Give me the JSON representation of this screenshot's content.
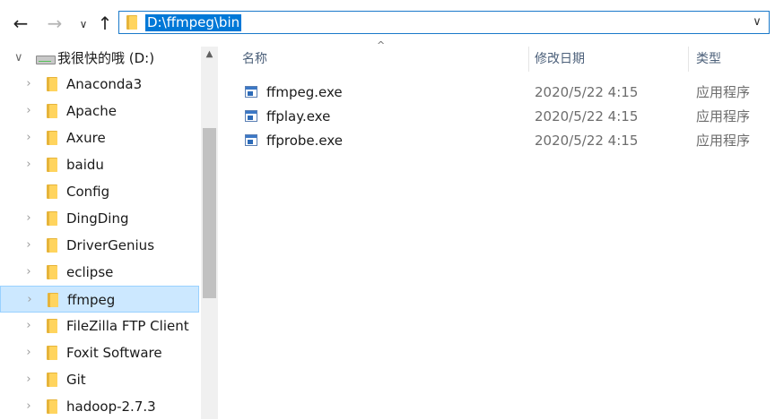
{
  "address_bar": {
    "back_icon": "arrow-left-icon",
    "forward_icon": "arrow-right-icon",
    "recent_icon": "chevron-down-icon",
    "up_icon": "arrow-up-icon",
    "path": "D:\\ffmpeg\\bin",
    "back_glyph": "←",
    "forward_glyph": "→",
    "recent_glyph": "∨",
    "up_glyph": "↑",
    "dropdown_glyph": "∨"
  },
  "nav_pane": {
    "drive": {
      "label": "我很快的哦 (D:)",
      "chevron": "∨"
    },
    "items": [
      {
        "label": "Anaconda3",
        "has_children": true,
        "selected": false
      },
      {
        "label": "Apache",
        "has_children": true,
        "selected": false
      },
      {
        "label": "Axure",
        "has_children": true,
        "selected": false
      },
      {
        "label": "baidu",
        "has_children": true,
        "selected": false
      },
      {
        "label": "Config",
        "has_children": false,
        "selected": false
      },
      {
        "label": "DingDing",
        "has_children": true,
        "selected": false
      },
      {
        "label": "DriverGenius",
        "has_children": true,
        "selected": false
      },
      {
        "label": "eclipse",
        "has_children": true,
        "selected": false
      },
      {
        "label": "ffmpeg",
        "has_children": true,
        "selected": true
      },
      {
        "label": "FileZilla FTP Client",
        "has_children": true,
        "selected": false
      },
      {
        "label": "Foxit Software",
        "has_children": true,
        "selected": false
      },
      {
        "label": "Git",
        "has_children": true,
        "selected": false
      },
      {
        "label": "hadoop-2.7.3",
        "has_children": true,
        "selected": false
      }
    ],
    "scroll_up_glyph": "▲",
    "scroll_position": 0.35
  },
  "content": {
    "sort_glyph": "^",
    "columns": {
      "name": "名称",
      "date": "修改日期",
      "type": "类型"
    },
    "files": [
      {
        "name": "ffmpeg.exe",
        "date": "2020/5/22 4:15",
        "type": "应用程序"
      },
      {
        "name": "ffplay.exe",
        "date": "2020/5/22 4:15",
        "type": "应用程序"
      },
      {
        "name": "ffprobe.exe",
        "date": "2020/5/22 4:15",
        "type": "应用程序"
      }
    ]
  }
}
